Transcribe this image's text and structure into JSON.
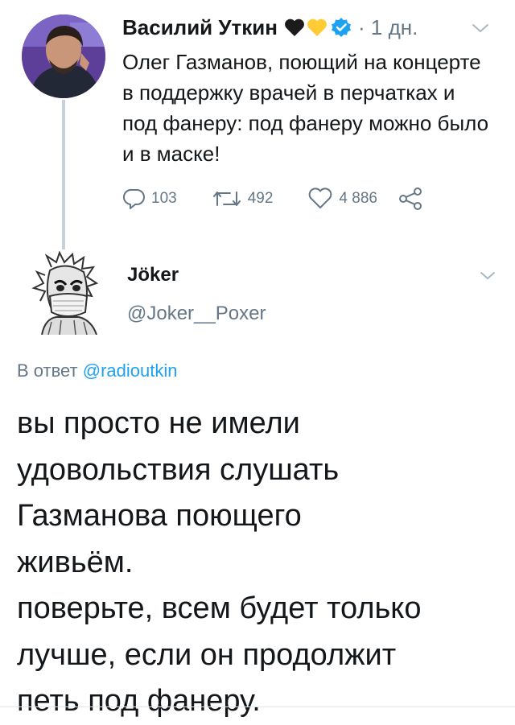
{
  "parent_tweet": {
    "author_name": "Василий Уткин",
    "timestamp": "· 1 дн.",
    "text": "Олег Газманов, поющий на концерте в поддержку врачей в перчатках и под фанеру: под фанеру можно было и в маске!",
    "replies_count": "103",
    "retweets_count": "492",
    "likes_count": "4 886"
  },
  "reply_tweet": {
    "author_name": "Jöker",
    "handle": "@Joker__Poxer",
    "reply_to_prefix": "В ответ",
    "reply_to_mention": "@radioutkin",
    "text": "вы просто не имели\nудовольствия слушать\nГазманова поющего\nживьём.\nповерьте, всем будет только\nлучше, если он продолжит\nпеть под фанеру."
  },
  "colors": {
    "text": "#14171a",
    "secondary": "#657786",
    "accent": "#1da1f2",
    "black_heart": "#1b1b1b",
    "yellow_heart": "#ffcc33"
  },
  "icons": [
    "reply-icon",
    "retweet-icon",
    "like-icon",
    "share-icon",
    "verified-icon",
    "chevron-down-icon"
  ]
}
